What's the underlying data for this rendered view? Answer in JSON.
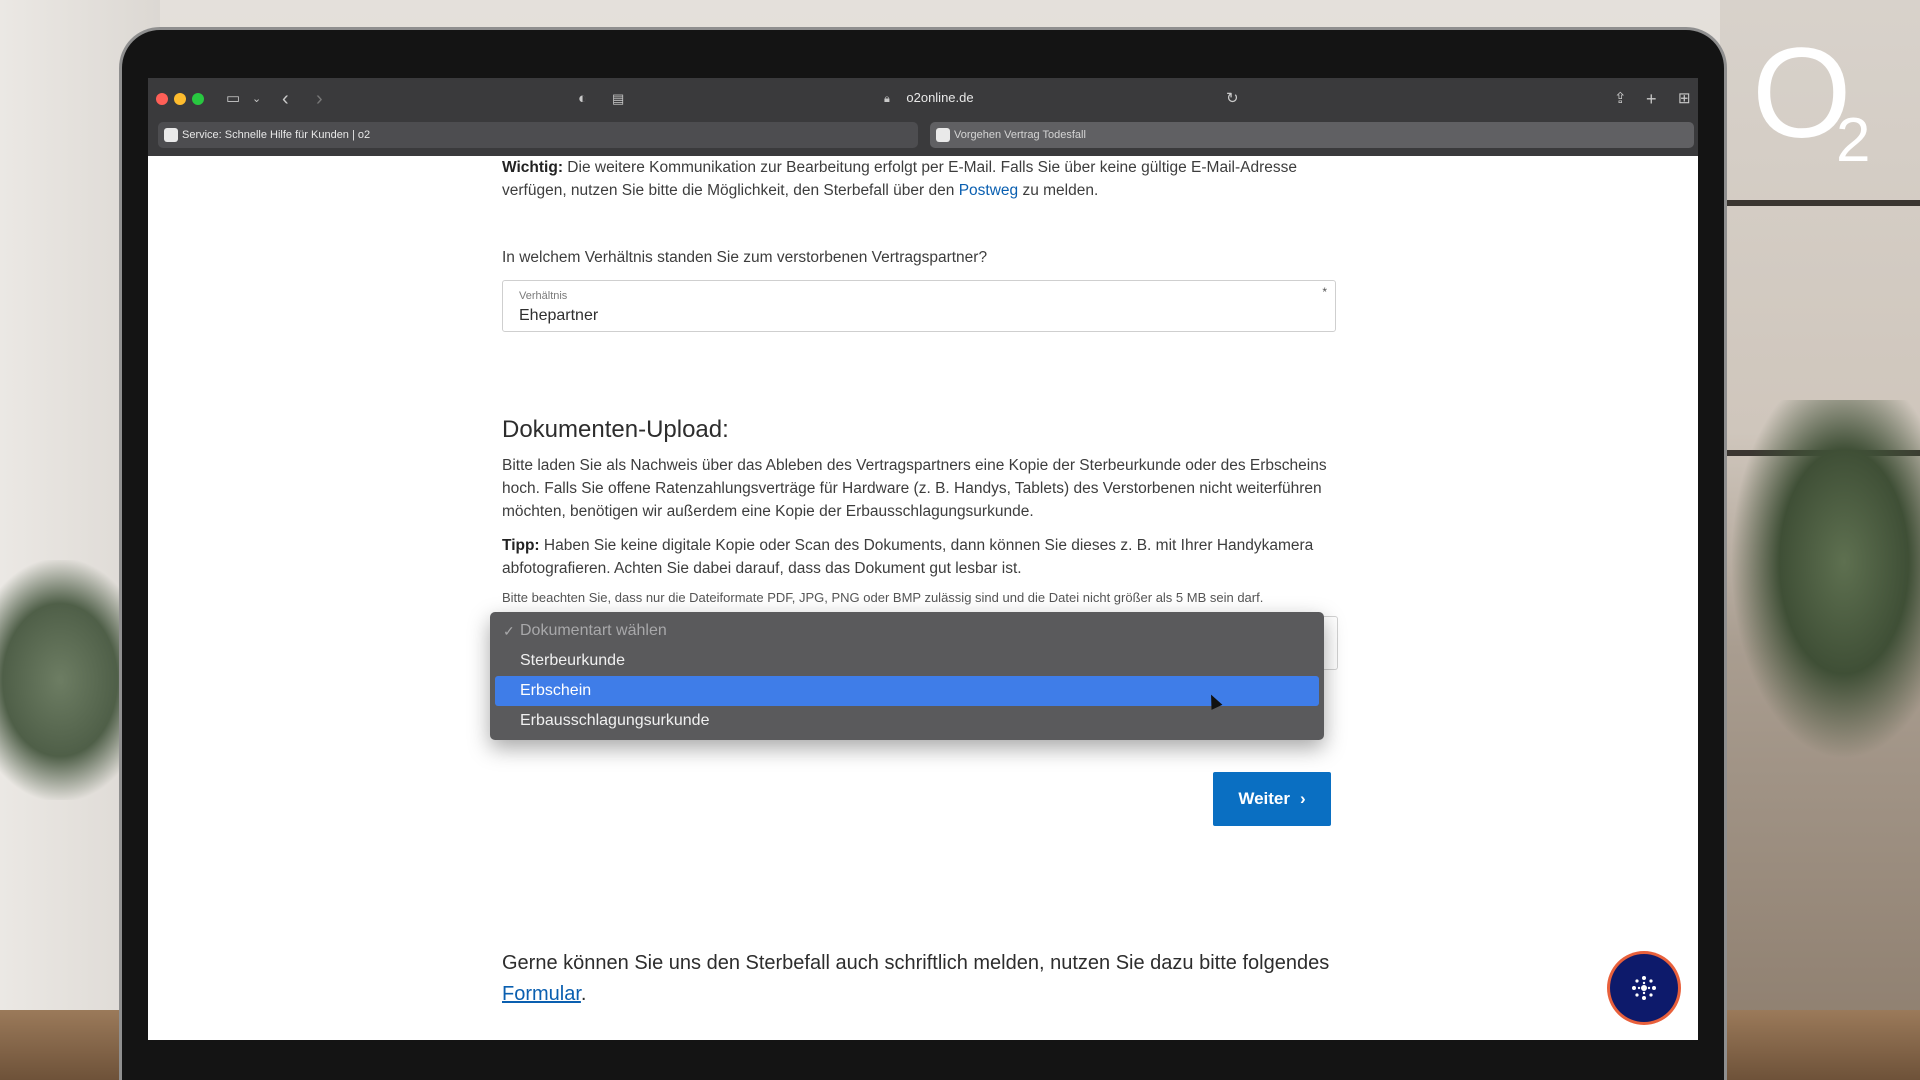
{
  "browser": {
    "url": "o2online.de",
    "tabs": [
      {
        "title": "Service: Schnelle Hilfe für Kunden | o2",
        "active": true
      },
      {
        "title": "Vorgehen Vertrag Todesfall",
        "active": false
      }
    ]
  },
  "brand": {
    "logo_main": "O",
    "logo_sub": "2"
  },
  "page": {
    "notice": {
      "label": "Wichtig:",
      "text_before_link": " Die weitere Kommunikation zur Bearbeitung erfolgt per E-Mail. Falls Sie über keine gültige E-Mail-Adresse verfügen, nutzen Sie bitte die Möglichkeit, den Sterbefall über den ",
      "link": "Postweg",
      "text_after_link": " zu melden."
    },
    "relation_question": "In welchem Verhältnis standen Sie zum verstorbenen Vertragspartner?",
    "relation_select": {
      "label": "Verhältnis",
      "value": "Ehepartner",
      "required_mark": "*"
    },
    "upload_heading": "Dokumenten-Upload:",
    "upload_text": "Bitte laden Sie als Nachweis über das Ableben des Vertragspartners eine Kopie der Sterbeurkunde oder des Erbscheins hoch. Falls Sie offene Ratenzahlungsverträge für Hardware (z. B. Handys, Tablets) des Verstorbenen nicht weiterführen möchten, benötigen wir außerdem eine Kopie der Erbausschlagungsurkunde.",
    "tip": {
      "label": "Tipp:",
      "text": " Haben Sie keine digitale Kopie oder Scan des Dokuments, dann können Sie dieses z. B. mit Ihrer Handykamera abfotografieren. Achten Sie dabei darauf, dass das Dokument gut lesbar ist."
    },
    "format_note": "Bitte beachten Sie, dass nur die Dateiformate PDF, JPG, PNG oder BMP zulässig sind und die Datei nicht größer als 5 MB sein darf.",
    "document_dropdown": {
      "options": [
        "Dokumentart wählen",
        "Sterbeurkunde",
        "Erbschein",
        "Erbausschlagungsurkunde"
      ],
      "checked_option": "Dokumentart wählen",
      "highlighted_option": "Erbschein"
    },
    "next_button": "Weiter",
    "bottom": {
      "text": "Gerne können Sie uns den Sterbefall auch schriftlich melden, nutzen Sie dazu bitte folgendes ",
      "link": "Formular",
      "end": "."
    }
  },
  "colors": {
    "link": "#0a5fb0",
    "button": "#0a6fc2",
    "highlight": "#3f7de8",
    "assistant": "#0d1a6b"
  }
}
